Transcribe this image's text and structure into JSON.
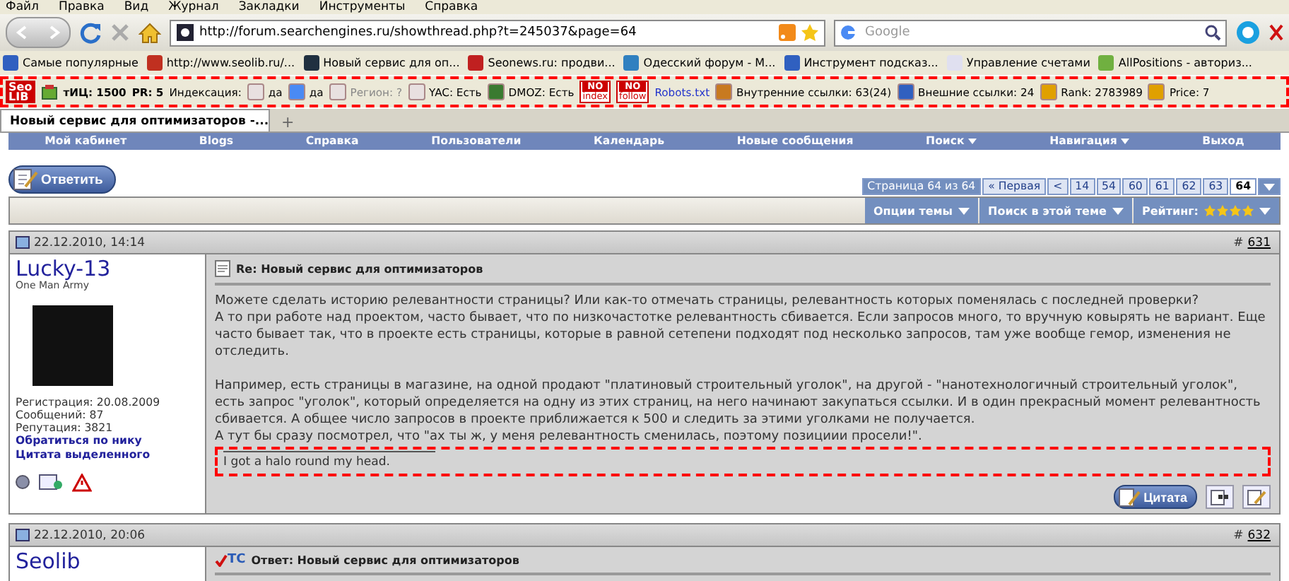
{
  "browser": {
    "menu": [
      "Файл",
      "Правка",
      "Вид",
      "Журнал",
      "Закладки",
      "Инструменты",
      "Справка"
    ],
    "address": "http://forum.searchengines.ru/showthread.php?t=245037&page=64",
    "search": {
      "placeholder": "Google"
    },
    "bookmarks": [
      "Самые популярные",
      "http://www.seolib.ru/...",
      "Новый сервис для оп...",
      "Seonews.ru: продви...",
      "Одесский форум - М...",
      "Инструмент подсказ...",
      "Управление счетами",
      "AllPositions - авториз..."
    ],
    "seo_toolbar": {
      "logo": [
        "Seo",
        "LIB"
      ],
      "items": [
        {
          "kind": "bold",
          "text": "тИЦ: 1500"
        },
        {
          "kind": "bold",
          "text": "PR: 5"
        },
        {
          "kind": "plain",
          "text": "Индексация:"
        },
        {
          "kind": "icon",
          "text": "да"
        },
        {
          "kind": "icon",
          "text": "да"
        },
        {
          "kind": "muted",
          "text": "Регион: ?"
        },
        {
          "kind": "icon",
          "text": "YAC: Есть"
        },
        {
          "kind": "icon",
          "text": "DMOZ: Есть"
        },
        {
          "kind": "no",
          "text": [
            "NO",
            "index"
          ]
        },
        {
          "kind": "no",
          "text": [
            "NO",
            "follow"
          ]
        },
        {
          "kind": "link",
          "text": "Robots.txt"
        },
        {
          "kind": "icon",
          "text": "Внутренние ссылки: 63(24)"
        },
        {
          "kind": "icon",
          "text": "Внешние ссылки: 24"
        },
        {
          "kind": "icon",
          "text": "Rank: 2783989"
        },
        {
          "kind": "icon",
          "text": "Price: 7"
        }
      ]
    },
    "tab": {
      "title": "Новый сервис для оптимизаторов -...",
      "new_tab": "+"
    }
  },
  "forum": {
    "nav": [
      {
        "label": "Мой кабинет",
        "has_menu": false
      },
      {
        "label": "Blogs",
        "has_menu": false
      },
      {
        "label": "Справка",
        "has_menu": false
      },
      {
        "label": "Пользователи",
        "has_menu": false
      },
      {
        "label": "Календарь",
        "has_menu": false
      },
      {
        "label": "Новые сообщения",
        "has_menu": false
      },
      {
        "label": "Поиск",
        "has_menu": true
      },
      {
        "label": "Навигация",
        "has_menu": true
      },
      {
        "label": "Выход",
        "has_menu": false
      }
    ],
    "reply_button": "Ответить",
    "pagination": {
      "summary": "Страница 64 из 64",
      "first": "« Первая",
      "prev": "<",
      "pages": [
        {
          "label": "14",
          "selected": false
        },
        {
          "label": "54",
          "selected": false
        },
        {
          "label": "60",
          "selected": false
        },
        {
          "label": "61",
          "selected": false
        },
        {
          "label": "62",
          "selected": false
        },
        {
          "label": "63",
          "selected": false
        },
        {
          "label": "64",
          "selected": true
        }
      ]
    },
    "thread_tools": [
      {
        "kind": "menu",
        "label": "Опции темы"
      },
      {
        "kind": "menu",
        "label": "Поиск в этой теме"
      },
      {
        "kind": "rating",
        "label": "Рейтинг:",
        "stars": 4
      }
    ]
  },
  "posts": [
    {
      "date": "22.12.2010, 14:14",
      "number_prefix": "#",
      "number": "631",
      "user": {
        "name": "Lucky-13",
        "title": "One Man Army",
        "stats": [
          "Регистрация: 20.08.2009",
          "Сообщений: 87",
          "Репутация: 3821"
        ],
        "links": [
          "Обратиться по нику",
          "Цитата выделенного"
        ],
        "online": false
      },
      "title": "Re: Новый сервис для оптимизаторов",
      "paragraphs": [
        [
          "Можете сделать историю релевантности страницы? Или как-то отмечать страницы, релевантность которых поменялась с последней проверки?",
          "А то при работе над проектом, часто бывает, что по низкочастотке релевантность сбивается. Если запросов много, то вручную ковырять не вариант. Еще часто бывает так, что в проекте есть страницы, которые в равной сетепени подходят под несколько запросов, там уже вообще гемор, изменения не отследить."
        ],
        [
          "Например, есть страницы в магазине, на одной продают \"платиновый строительный уголок\", на другой - \"нанотехнологичный строительный уголок\", есть запрос \"уголок\", который определяется на одну из этих страниц, на него начинают закупаться ссылки. И в один прекрасный момент релевантность сбивается. А общее число запросов в проекте приближается к 500 и следить за этими уголками не получается.",
          "А тут бы сразу посмотрел, что \"ах ты ж, у меня релевантность сменилась, поэтому позициии просели!\"."
        ]
      ],
      "signature": "I got a halo round my head.",
      "quote_button": "Цитата"
    },
    {
      "date": "22.12.2010, 20:06",
      "number_prefix": "#",
      "number": "632",
      "user": {
        "name": "Seolib"
      },
      "badge": "TC",
      "title": "Ответ: Новый сервис для оптимизаторов"
    }
  ]
}
